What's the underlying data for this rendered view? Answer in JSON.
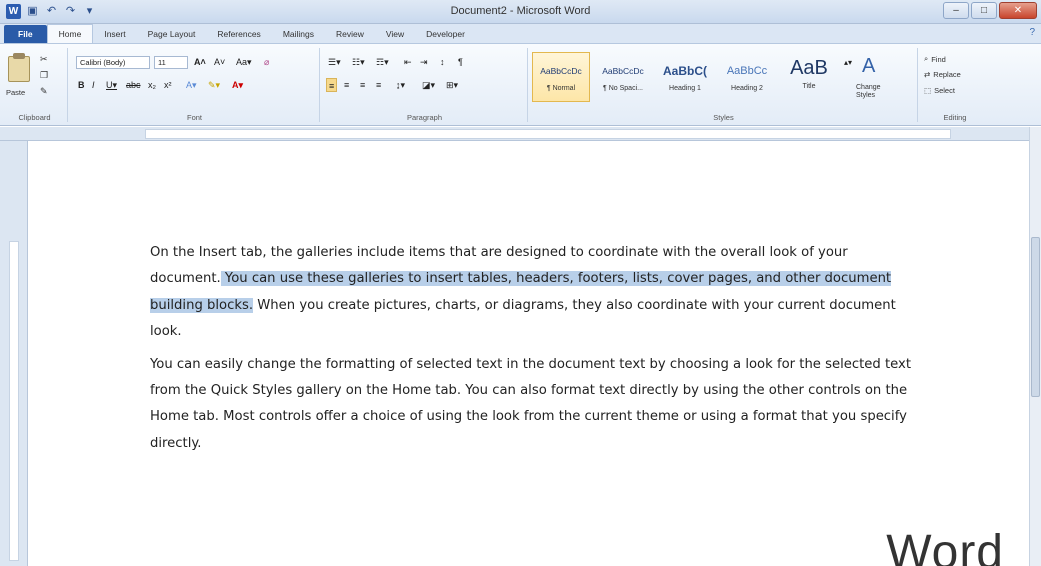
{
  "title": "Document2 - Microsoft Word",
  "help_icon": "help-icon",
  "tabs": [
    {
      "label": "File"
    },
    {
      "label": "Home"
    },
    {
      "label": "Insert"
    },
    {
      "label": "Page Layout"
    },
    {
      "label": "References"
    },
    {
      "label": "Mailings"
    },
    {
      "label": "Review"
    },
    {
      "label": "View"
    },
    {
      "label": "Developer"
    }
  ],
  "clipboard": {
    "paste_label": "Paste",
    "group_label": "Clipboard"
  },
  "font": {
    "family": "Calibri (Body)",
    "size": "11",
    "group_label": "Font"
  },
  "paragraph": {
    "group_label": "Paragraph"
  },
  "styles": {
    "group_label": "Styles",
    "items": [
      {
        "sample": "AaBbCcDc",
        "name": "¶ Normal"
      },
      {
        "sample": "AaBbCcDc",
        "name": "¶ No Spaci..."
      },
      {
        "sample": "AaBbC(",
        "name": "Heading 1"
      },
      {
        "sample": "AaBbCc",
        "name": "Heading 2"
      },
      {
        "sample": "AaB",
        "name": "Title"
      }
    ],
    "change_styles": "Change Styles"
  },
  "editing": {
    "group_label": "Editing",
    "find": "Find",
    "replace": "Replace",
    "select": "Select"
  },
  "document": {
    "p1_a": "On the Insert tab, the galleries include items that are designed to coordinate with the overall look of your document.",
    "p1_sel": " You can use these galleries to insert tables, headers, footers, lists, cover pages, and other document building blocks.",
    "p1_b": " When you create pictures, charts, or diagrams, they also coordinate with your current document look.",
    "p2": "You can easily change the formatting of selected text in the document text by choosing a look for the selected text from the Quick Styles gallery on the Home tab. You can also format text directly by using the other controls on the Home tab. Most controls offer a choice of using the look from the current theme or using a format that you specify directly."
  },
  "watermark": "Word",
  "colors": {
    "accent": "#2a5ba8",
    "selection": "#b8cfe9"
  }
}
